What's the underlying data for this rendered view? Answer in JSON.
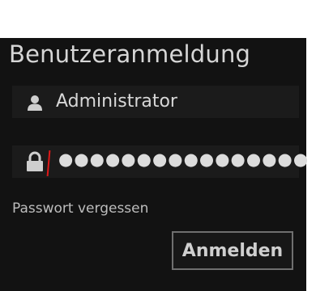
{
  "login": {
    "title": "Benutzeranmeldung",
    "username": {
      "value": "Administrator",
      "icon": "user-icon"
    },
    "password": {
      "masked_value": "●●●●●●●●●●●●●●●●",
      "icon": "lock-icon"
    },
    "forgot_password_label": "Passwort vergessen",
    "submit_label": "Anmelden"
  },
  "colors": {
    "panel_background": "#121212",
    "field_background": "#1b1b1b",
    "text": "#d6d6d6",
    "caret": "#e01818",
    "button_border": "#6f6f6f"
  }
}
